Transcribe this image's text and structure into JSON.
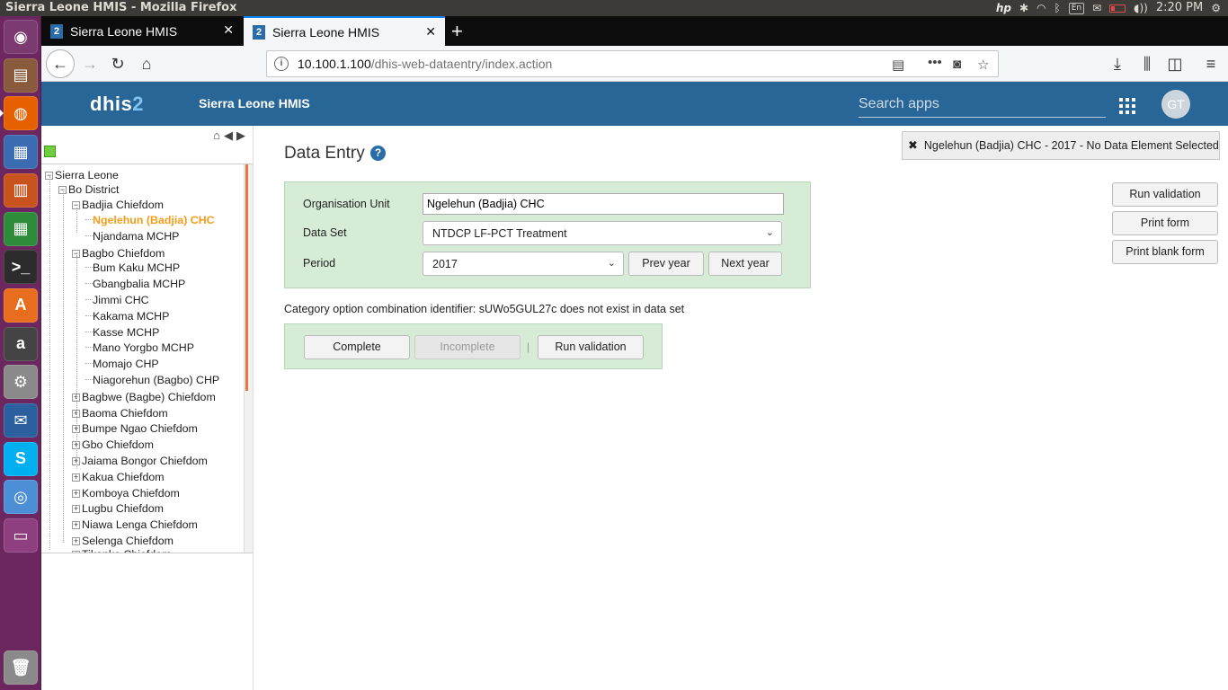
{
  "os": {
    "window_title": "Sierra Leone HMIS - Mozilla Firefox",
    "tray": {
      "keyboard": "En",
      "clock": "2:20 PM"
    },
    "launcher": [
      {
        "name": "ubuntu-dash-icon",
        "color": "#7b3b70"
      },
      {
        "name": "files-icon",
        "color": "#8a5a3c"
      },
      {
        "name": "firefox-icon",
        "color": "#e66000"
      },
      {
        "name": "writer-icon",
        "color": "#3b6bb0"
      },
      {
        "name": "impress-icon",
        "color": "#c9531e"
      },
      {
        "name": "calc-icon",
        "color": "#2e8b3a"
      },
      {
        "name": "terminal-icon",
        "color": "#2c2c2c"
      },
      {
        "name": "software-center-icon",
        "color": "#e86d1f"
      },
      {
        "name": "amazon-icon",
        "color": "#444444"
      },
      {
        "name": "settings-icon",
        "color": "#8a8a8a"
      },
      {
        "name": "thunderbird-icon",
        "color": "#2b5f9e"
      },
      {
        "name": "skype-icon",
        "color": "#00aff0"
      },
      {
        "name": "chromium-icon",
        "color": "#4c8fd6"
      },
      {
        "name": "workspace-switcher-icon",
        "color": "#8e3f7f"
      }
    ],
    "trash": "trash-icon"
  },
  "browser": {
    "tabs": [
      {
        "favicon": "2",
        "label": "Sierra Leone HMIS",
        "active": false
      },
      {
        "favicon": "2",
        "label": "Sierra Leone HMIS",
        "active": true
      }
    ],
    "url_host": "10.100.1.100",
    "url_path": "/dhis-web-dataentry/index.action"
  },
  "header": {
    "logo_main": "dhis",
    "logo_num": "2",
    "instance": "Sierra Leone HMIS",
    "search_placeholder": "Search apps",
    "profile_initials": "GT",
    "color": "#276696"
  },
  "tree": {
    "nodes": [
      {
        "label": "Sierra Leone",
        "toggle": "-"
      },
      {
        "label": "Bo District",
        "toggle": "-"
      },
      {
        "label": "Badjia Chiefdom",
        "toggle": "-"
      },
      {
        "label": "Ngelehun (Badjia) CHC",
        "toggle": ""
      },
      {
        "label": "Njandama MCHP",
        "toggle": ""
      },
      {
        "label": "Bagbo Chiefdom",
        "toggle": "-"
      },
      {
        "label": "Bum Kaku MCHP",
        "toggle": ""
      },
      {
        "label": "Gbangbalia MCHP",
        "toggle": ""
      },
      {
        "label": "Jimmi CHC",
        "toggle": ""
      },
      {
        "label": "Kakama MCHP",
        "toggle": ""
      },
      {
        "label": "Kasse MCHP",
        "toggle": ""
      },
      {
        "label": "Mano Yorgbo MCHP",
        "toggle": ""
      },
      {
        "label": "Momajo CHP",
        "toggle": ""
      },
      {
        "label": "Niagorehun (Bagbo) CHP",
        "toggle": ""
      },
      {
        "label": "Bagbwe (Bagbe) Chiefdom",
        "toggle": "+"
      },
      {
        "label": "Baoma Chiefdom",
        "toggle": "+"
      },
      {
        "label": "Bumpe Ngao Chiefdom",
        "toggle": "+"
      },
      {
        "label": "Gbo Chiefdom",
        "toggle": "+"
      },
      {
        "label": "Jaiama Bongor Chiefdom",
        "toggle": "+"
      },
      {
        "label": "Kakua Chiefdom",
        "toggle": "+"
      },
      {
        "label": "Komboya Chiefdom",
        "toggle": "+"
      },
      {
        "label": "Lugbu Chiefdom",
        "toggle": "+"
      },
      {
        "label": "Niawa Lenga Chiefdom",
        "toggle": "+"
      },
      {
        "label": "Selenga Chiefdom",
        "toggle": "+"
      },
      {
        "label": "Tikonko Chiefdom",
        "toggle": "+"
      }
    ],
    "selected": "Ngelehun (Badjia) CHC",
    "selected_color": "#f59d1a"
  },
  "main": {
    "title": "Data Entry",
    "help": "?",
    "info": "Ngelehun (Badjia) CHC - 2017 - No Data Element Selected",
    "side_buttons": [
      "Run validation",
      "Print form",
      "Print blank form"
    ],
    "form": {
      "org_unit_label": "Organisation Unit",
      "org_unit_value": "Ngelehun (Badjia) CHC",
      "dataset_label": "Data Set",
      "dataset_value": "NTDCP LF-PCT Treatment",
      "period_label": "Period",
      "period_value": "2017",
      "prev_year": "Prev year",
      "next_year": "Next year",
      "bg_color": "#d6ecd6"
    },
    "message": "Category option combination identifier: sUWo5GUL27c does not exist in data set",
    "actions": {
      "complete": "Complete",
      "incomplete": "Incomplete",
      "separator": "|",
      "run_validation": "Run validation"
    }
  }
}
